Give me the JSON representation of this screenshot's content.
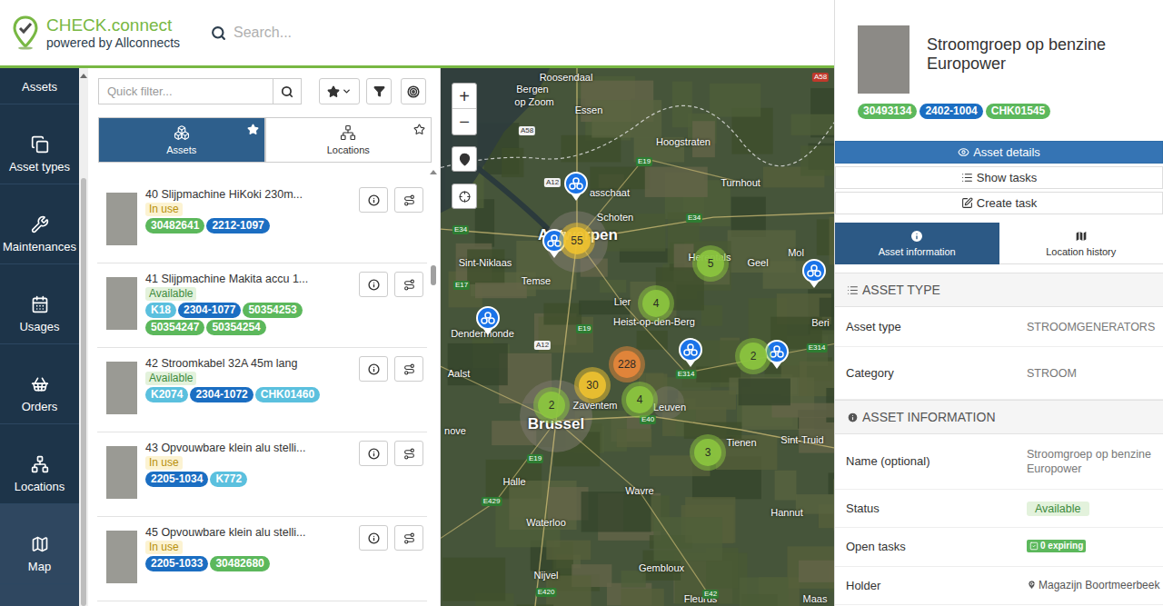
{
  "header": {
    "brand": "CHECK.connect",
    "tagline": "powered by Allconnects",
    "search_placeholder": "Search..."
  },
  "nav": [
    {
      "label": "Assets",
      "selected": false
    },
    {
      "label": "Asset types",
      "selected": false
    },
    {
      "label": "Maintenances",
      "selected": false
    },
    {
      "label": "Usages",
      "selected": false
    },
    {
      "label": "Orders",
      "selected": false
    },
    {
      "label": "Locations",
      "selected": false
    },
    {
      "label": "Map",
      "selected": true
    }
  ],
  "list_panel": {
    "filter_placeholder": "Quick filter...",
    "tabs": [
      {
        "label": "Assets",
        "selected": true,
        "starred": true
      },
      {
        "label": "Locations",
        "selected": false,
        "starred": false
      }
    ],
    "items": [
      {
        "title": "40 Slijpmachine HiKoki 230m...",
        "status": "In use",
        "status_kind": "in-use",
        "tags": [
          {
            "text": "30482641",
            "color": "#5cb85c"
          },
          {
            "text": "2212-1097",
            "color": "#1b6ec2"
          }
        ]
      },
      {
        "title": "41 Slijpmachine Makita accu 1...",
        "status": "Available",
        "status_kind": "available",
        "tags": [
          {
            "text": "K18",
            "color": "#5bc0de"
          },
          {
            "text": "2304-1077",
            "color": "#1b6ec2"
          },
          {
            "text": "50354253",
            "color": "#5cb85c"
          },
          {
            "text": "50354247",
            "color": "#5cb85c"
          },
          {
            "text": "50354254",
            "color": "#5cb85c"
          }
        ]
      },
      {
        "title": "42 Stroomkabel 32A 45m lang",
        "status": "Available",
        "status_kind": "available",
        "tags": [
          {
            "text": "K2074",
            "color": "#5bc0de"
          },
          {
            "text": "2304-1072",
            "color": "#1b6ec2"
          },
          {
            "text": "CHK01460",
            "color": "#5bc0de"
          }
        ]
      },
      {
        "title": "43 Opvouwbare klein alu stelli...",
        "status": "In use",
        "status_kind": "in-use",
        "tags": [
          {
            "text": "2205-1034",
            "color": "#1b6ec2"
          },
          {
            "text": "K772",
            "color": "#5bc0de"
          }
        ]
      },
      {
        "title": "45 Opvouwbare klein alu stelli...",
        "status": "In use",
        "status_kind": "in-use",
        "tags": [
          {
            "text": "2205-1033",
            "color": "#1b6ec2"
          },
          {
            "text": "30482680",
            "color": "#5cb85c"
          }
        ]
      }
    ]
  },
  "map": {
    "labels": [
      {
        "text": "Roosendaal",
        "kind": "city"
      },
      {
        "text": "Bergen",
        "kind": "city"
      },
      {
        "text": "op Zoom",
        "kind": "city"
      },
      {
        "text": "Essen",
        "kind": "city"
      },
      {
        "text": "Hoogstraten",
        "kind": "city"
      },
      {
        "text": "Turnhout",
        "kind": "city"
      },
      {
        "text": "asschaat",
        "kind": "city"
      },
      {
        "text": "Schoten",
        "kind": "city"
      },
      {
        "text": "Antwerpen",
        "kind": "big-city"
      },
      {
        "text": "Sint-Niklaas",
        "kind": "city"
      },
      {
        "text": "Temse",
        "kind": "city"
      },
      {
        "text": "Herentals",
        "kind": "city"
      },
      {
        "text": "Geel",
        "kind": "city"
      },
      {
        "text": "Mol",
        "kind": "city"
      },
      {
        "text": "Lier",
        "kind": "city"
      },
      {
        "text": "Heist-op-den-Berg",
        "kind": "city"
      },
      {
        "text": "Dendermonde",
        "kind": "city"
      },
      {
        "text": "Aalst",
        "kind": "city"
      },
      {
        "text": "Zaventem",
        "kind": "city"
      },
      {
        "text": "Brussel",
        "kind": "big-city"
      },
      {
        "text": "Leuven",
        "kind": "city"
      },
      {
        "text": "Tienen",
        "kind": "city"
      },
      {
        "text": "Sint-Truid",
        "kind": "city"
      },
      {
        "text": "Beri",
        "kind": "city"
      },
      {
        "text": "nove",
        "kind": "city"
      },
      {
        "text": "Halle",
        "kind": "city"
      },
      {
        "text": "Waterloo",
        "kind": "city"
      },
      {
        "text": "Wavre",
        "kind": "city"
      },
      {
        "text": "Hannut",
        "kind": "city"
      },
      {
        "text": "Nijvel",
        "kind": "city"
      },
      {
        "text": "Gembloux",
        "kind": "city"
      },
      {
        "text": "Fleurus",
        "kind": "city"
      },
      {
        "text": "Maas",
        "kind": "city"
      },
      {
        "text": "A58",
        "kind": "a-road"
      },
      {
        "text": "A58",
        "kind": "nl-road"
      },
      {
        "text": "A12",
        "kind": "a-road"
      },
      {
        "text": "E19",
        "kind": "e-road"
      },
      {
        "text": "E34",
        "kind": "e-road"
      },
      {
        "text": "E34",
        "kind": "e-road"
      },
      {
        "text": "E17",
        "kind": "e-road"
      },
      {
        "text": "E19",
        "kind": "e-road"
      },
      {
        "text": "A12",
        "kind": "a-road"
      },
      {
        "text": "E314",
        "kind": "e-road"
      },
      {
        "text": "E314",
        "kind": "e-road"
      },
      {
        "text": "E40",
        "kind": "e-road"
      },
      {
        "text": "E19",
        "kind": "e-road"
      },
      {
        "text": "E429",
        "kind": "e-road"
      },
      {
        "text": "E420",
        "kind": "e-road"
      },
      {
        "text": "E42",
        "kind": "e-road"
      }
    ],
    "clusters": [
      {
        "count": "55",
        "color": "#f0c330"
      },
      {
        "count": "5",
        "color": "#8cc63f"
      },
      {
        "count": "4",
        "color": "#8cc63f"
      },
      {
        "count": "228",
        "color": "#e8873a"
      },
      {
        "count": "30",
        "color": "#f0c330"
      },
      {
        "count": "2",
        "color": "#8cc63f"
      },
      {
        "count": "4",
        "color": "#8cc63f"
      },
      {
        "count": "2",
        "color": "#8cc63f"
      },
      {
        "count": "3",
        "color": "#8cc63f"
      }
    ],
    "controls": {
      "zoom_in": "+",
      "zoom_out": "−"
    }
  },
  "detail": {
    "title": "Stroomgroep op benzine Europower",
    "tags": [
      {
        "text": "30493134",
        "color": "#5cb85c"
      },
      {
        "text": "2402-1004",
        "color": "#1b6ec2"
      },
      {
        "text": "CHK01545",
        "color": "#5cb85c"
      }
    ],
    "actions": [
      {
        "label": "Asset details",
        "selected": true
      },
      {
        "label": "Show tasks",
        "selected": false
      },
      {
        "label": "Create task",
        "selected": false
      }
    ],
    "tabs": [
      {
        "label": "Asset information",
        "selected": true
      },
      {
        "label": "Location history",
        "selected": false
      }
    ],
    "sections": [
      {
        "title": "ASSET TYPE",
        "rows": [
          {
            "label": "Asset type",
            "value": "STROOMGENERATORS",
            "kind": "text"
          },
          {
            "label": "Category",
            "value": "STROOM",
            "kind": "text"
          }
        ]
      },
      {
        "title": "ASSET INFORMATION",
        "rows": [
          {
            "label": "Name (optional)",
            "value": "Stroomgroep op benzine Europower",
            "kind": "text"
          },
          {
            "label": "Status",
            "value": "Available",
            "kind": "badge"
          },
          {
            "label": "Open tasks",
            "value": "0 expiring",
            "kind": "tasks"
          },
          {
            "label": "Holder",
            "value": "Magazijn Boortmeerbeek",
            "kind": "holder"
          }
        ]
      }
    ]
  }
}
